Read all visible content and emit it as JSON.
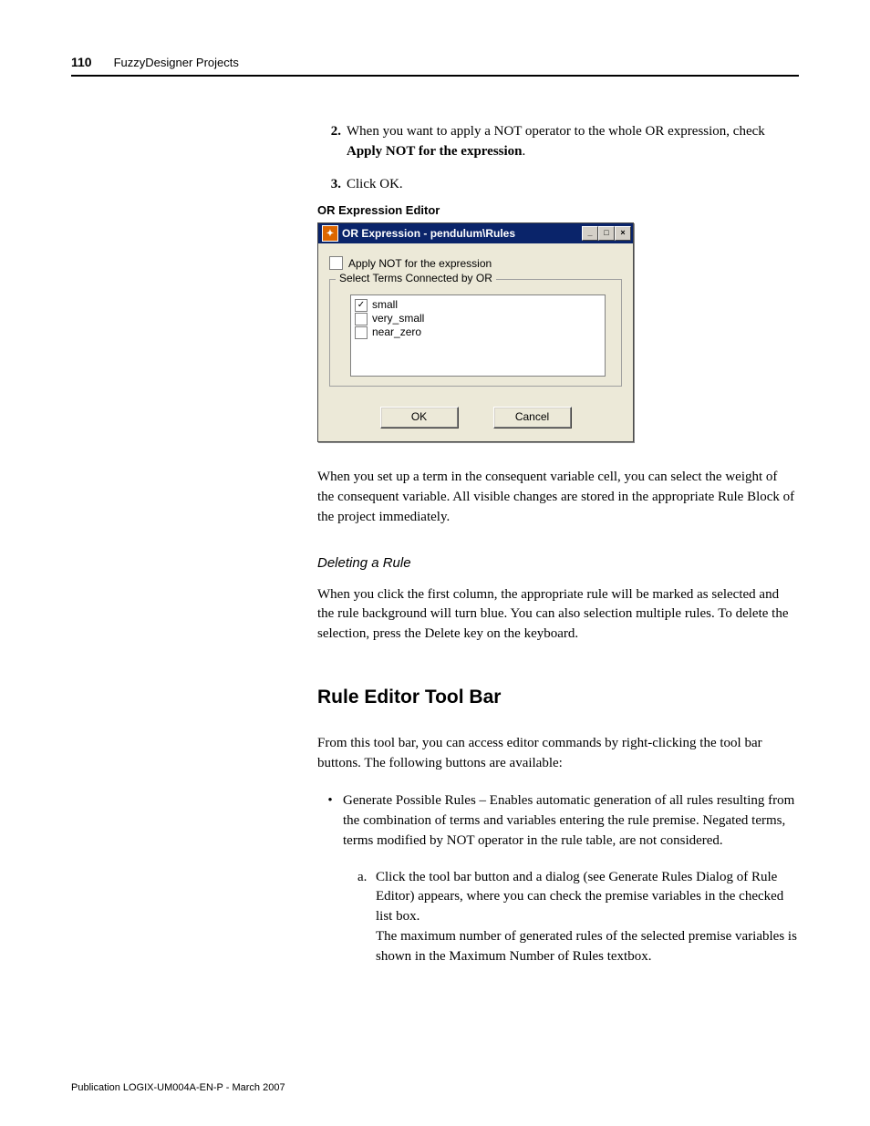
{
  "header": {
    "page_number": "110",
    "section": "FuzzyDesigner Projects"
  },
  "steps": {
    "s2_pre": "When you want to apply a NOT operator to the whole OR expression, check ",
    "s2_bold": "Apply NOT for the expression",
    "s2_post": ".",
    "s3": "Click OK."
  },
  "caption": "OR Expression Editor",
  "dialog": {
    "title": "OR Expression - pendulum\\Rules",
    "apply_not_label": "Apply NOT for the expression",
    "group_label": "Select Terms Connected by OR",
    "terms": {
      "t1": "small",
      "t2": "very_small",
      "t3": "near_zero"
    },
    "ok": "OK",
    "cancel": "Cancel"
  },
  "para_after_dialog": "When you set up a term in the consequent variable cell, you can select the weight of the consequent variable. All visible changes are stored in the appropriate Rule Block of the project immediately.",
  "deleting_heading": "Deleting a Rule",
  "deleting_para": "When you click the first column, the appropriate rule will be marked as selected and the rule background will turn blue. You can also selection multiple rules. To delete the selection, press the Delete key on the keyboard.",
  "toolbar_heading": "Rule Editor Tool Bar",
  "toolbar_intro": "From this tool bar, you can access editor commands by right-clicking the tool bar buttons. The following buttons are available:",
  "bullet1": "Generate Possible Rules – Enables automatic generation of all rules resulting from the combination of terms and variables entering the rule premise. Negated terms, terms modified by NOT operator in the rule table, are not considered.",
  "sub_a_1": "Click the tool bar button and a dialog (see Generate Rules Dialog of Rule Editor) appears, where you can check the premise variables in the checked list box.",
  "sub_a_2": "The maximum number of generated rules of the selected premise variables is shown in the Maximum Number of Rules textbox.",
  "footer": "Publication LOGIX-UM004A-EN-P - March 2007"
}
